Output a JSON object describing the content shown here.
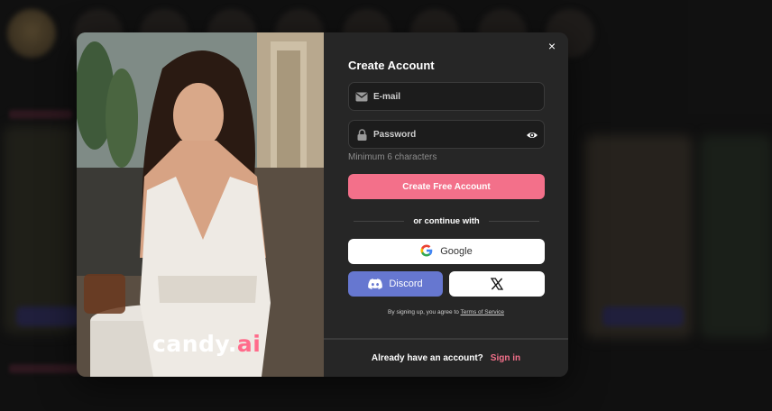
{
  "modal": {
    "title": "Create Account",
    "close_symbol": "×",
    "email_placeholder": "E-mail",
    "password_placeholder": "Password",
    "password_hint": "Minimum 6 characters",
    "primary_button": "Create Free Account",
    "divider_text": "or continue with",
    "google_label": "Google",
    "discord_label": "Discord",
    "terms_prefix": "By signing up, you agree to",
    "terms_link": "Terms of Service",
    "footer_question": "Already have an account?",
    "footer_link": "Sign in"
  },
  "brand": {
    "logo_main": "candy.",
    "logo_accent": "ai"
  },
  "icons": {
    "close": "close-icon",
    "email": "mail-icon",
    "password": "lock-icon",
    "show_password": "eye-icon",
    "google": "google-icon",
    "discord": "discord-icon",
    "x": "x-logo-icon"
  },
  "colors": {
    "accent": "#f3708a",
    "discord": "#6677d0",
    "panel_bg": "#262626",
    "input_bg": "#1c1c1c"
  }
}
